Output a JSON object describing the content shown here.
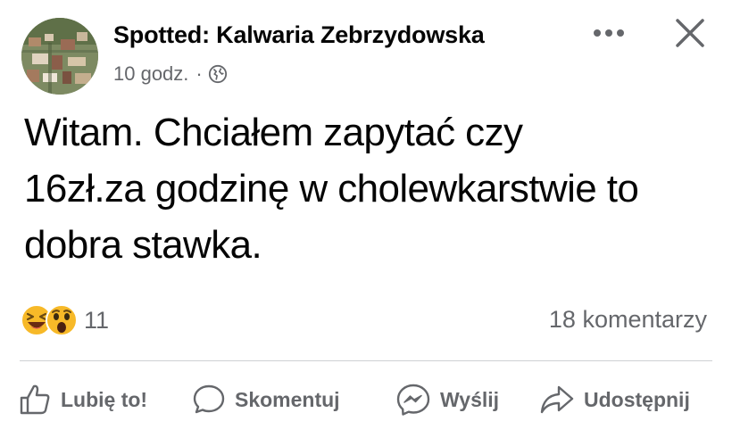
{
  "post": {
    "page_name": "Spotted: Kalwaria Zebrzydowska",
    "time": "10 godz.",
    "separator": "·",
    "privacy_icon": "globe-icon",
    "text_lines": [
      "Witam. Chciałem zapytać czy",
      "16zł.za godzinę w cholewkarstwie to",
      "dobra stawka."
    ]
  },
  "header": {
    "more_icon": "more-options-icon",
    "close_icon": "close-icon"
  },
  "reactions": {
    "icons": [
      "laughing-emoji-icon",
      "surprised-emoji-icon"
    ],
    "count": "11"
  },
  "comments": {
    "label": "18 komentarzy"
  },
  "actions": {
    "like": "Lubię to!",
    "comment": "Skomentuj",
    "send": "Wyślij",
    "share": "Udostępnij"
  },
  "colors": {
    "text": "#050505",
    "secondary": "#65676b",
    "divider": "#ced0d4",
    "emoji_yellow": "#f7b928"
  }
}
